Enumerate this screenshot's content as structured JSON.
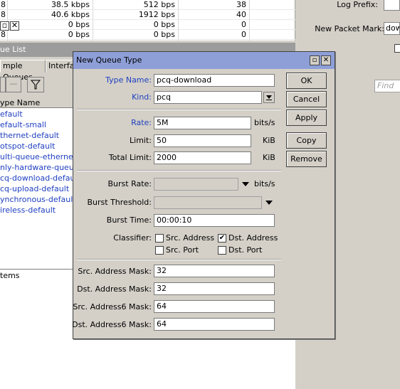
{
  "top_table": {
    "rows": [
      {
        "a": "8",
        "b": "38.5 kbps",
        "c": "512 bps",
        "d": "38"
      },
      {
        "a": "8",
        "b": "40.6 kbps",
        "c": "1912 bps",
        "d": "40"
      },
      {
        "a": "",
        "b": "0 bps",
        "c": "0 bps",
        "d": "0"
      },
      {
        "a": "8",
        "b": "0 bps",
        "c": "0 bps",
        "d": "0"
      }
    ]
  },
  "right_panel": {
    "log_prefix_label": "Log Prefix:",
    "new_packet_mark_label": "New Packet Mark:",
    "new_packet_mark_value": "dow"
  },
  "queue_list": {
    "title": "ue List",
    "tabs": [
      "mple Queues",
      "Interfa"
    ],
    "column_header": "ype Name",
    "items": [
      "efault",
      "efault-small",
      "thernet-default",
      "otspot-default",
      "ulti-queue-ethernet-d",
      "nly-hardware-queue",
      "cq-download-default",
      "cq-upload-default",
      "ynchronous-default",
      "ireless-default"
    ],
    "status": "tems",
    "find_placeholder": "Find"
  },
  "dialog": {
    "title": "New Queue Type",
    "type_name_label": "Type Name:",
    "type_name_value": "pcq-download",
    "kind_label": "Kind:",
    "kind_value": "pcq",
    "rate_label": "Rate:",
    "rate_value": "5M",
    "rate_unit": "bits/s",
    "limit_label": "Limit:",
    "limit_value": "50",
    "limit_unit": "KiB",
    "total_limit_label": "Total Limit:",
    "total_limit_value": "2000",
    "total_limit_unit": "KiB",
    "burst_rate_label": "Burst Rate:",
    "burst_rate_value": "",
    "burst_rate_unit": "bits/s",
    "burst_threshold_label": "Burst Threshold:",
    "burst_threshold_value": "",
    "burst_time_label": "Burst Time:",
    "burst_time_value": "00:00:10",
    "classifier_label": "Classifier:",
    "classifier": {
      "src_address": {
        "label": "Src. Address",
        "checked": false
      },
      "dst_address": {
        "label": "Dst. Address",
        "checked": true
      },
      "src_port": {
        "label": "Src. Port",
        "checked": false
      },
      "dst_port": {
        "label": "Dst. Port",
        "checked": false
      }
    },
    "src_mask_label": "Src. Address Mask:",
    "src_mask_value": "32",
    "dst_mask_label": "Dst. Address Mask:",
    "dst_mask_value": "32",
    "src6_mask_label": "Src. Address6 Mask:",
    "src6_mask_value": "64",
    "dst6_mask_label": "Dst. Address6 Mask:",
    "dst6_mask_value": "64",
    "buttons": {
      "ok": "OK",
      "cancel": "Cancel",
      "apply": "Apply",
      "copy": "Copy",
      "remove": "Remove"
    },
    "check_mark": "✔"
  },
  "colors": {
    "title_bar": "#8e9fd8",
    "link_blue": "#2040c0"
  }
}
